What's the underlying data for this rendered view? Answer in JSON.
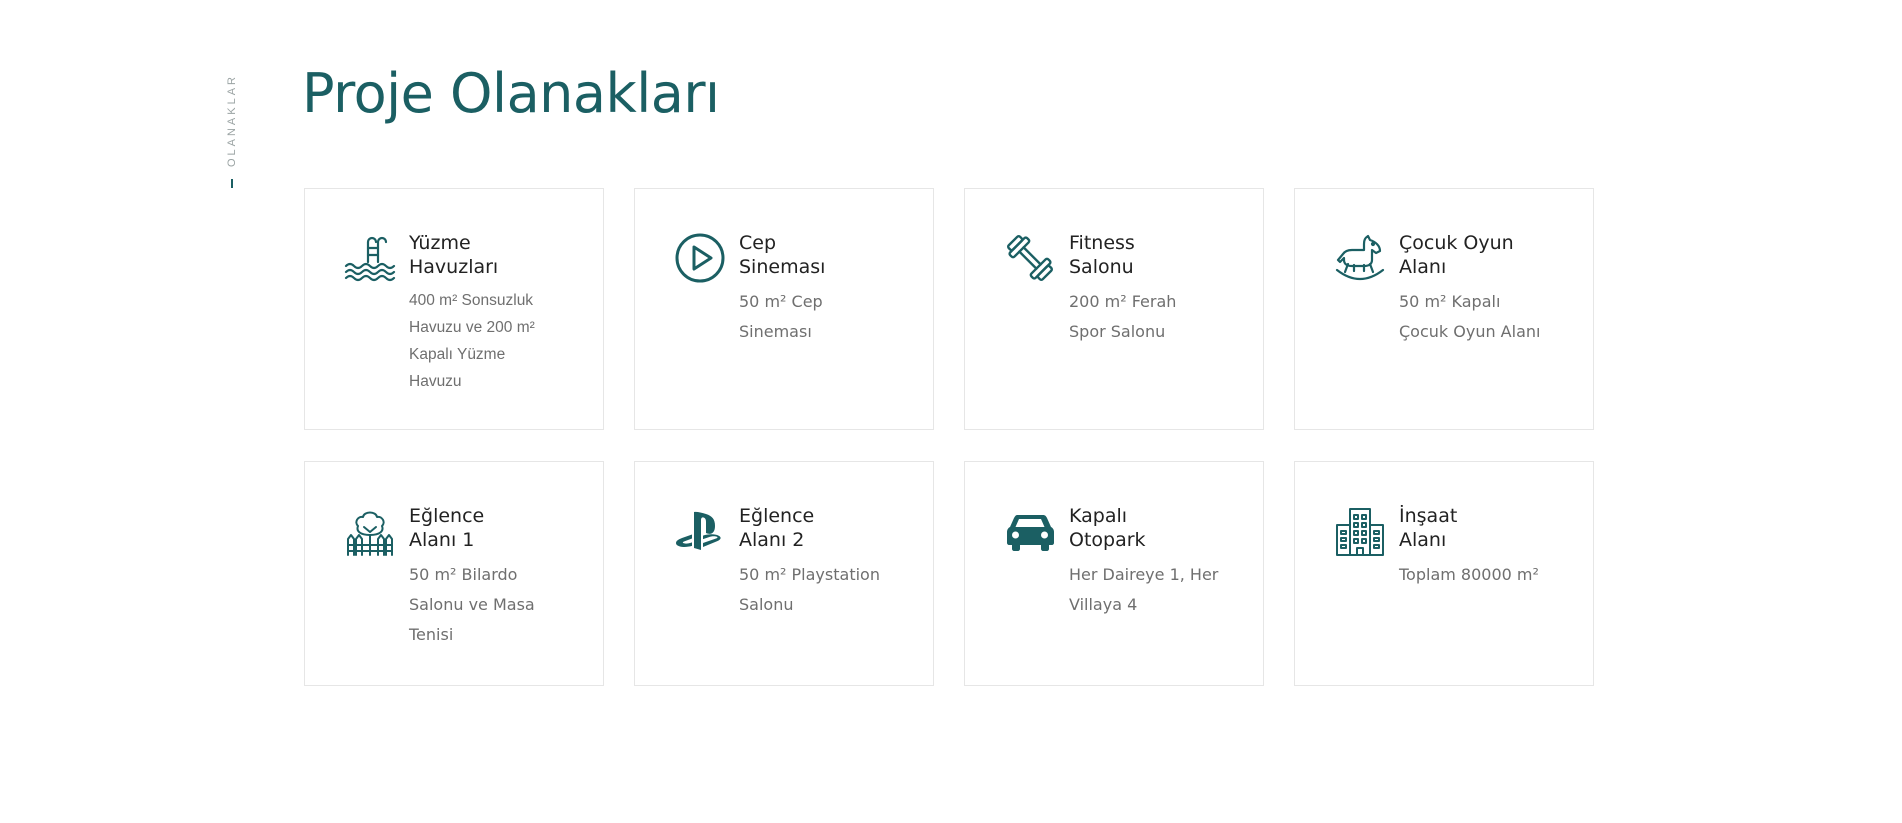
{
  "section": {
    "side_label": "OLANAKLAR",
    "title": "Proje Olanakları"
  },
  "colors": {
    "accent": "#1b5f63",
    "card_border": "#e6e6e6",
    "text": "#222222",
    "muted": "#6f6f6f"
  },
  "amenities": [
    {
      "icon": "swimming-pool-icon",
      "name": "Yüzme\nHavuzları",
      "desc": "400 m² Sonsuzluk\nHavuzu ve 200 m²\nKapalı Yüzme\nHavuzu"
    },
    {
      "icon": "play-icon",
      "name": "Cep\nSineması",
      "desc": "50 m² Cep\nSineması"
    },
    {
      "icon": "dumbbell-icon",
      "name": "Fitness\nSalonu",
      "desc": "200 m² Ferah\nSpor Salonu"
    },
    {
      "icon": "rocking-horse-icon",
      "name": "Çocuk Oyun\nAlanı",
      "desc": "50 m² Kapalı\nÇocuk Oyun Alanı"
    },
    {
      "icon": "park-icon",
      "name": "Eğlence\nAlanı 1",
      "desc": "50 m² Bilardo\nSalonu ve Masa\nTenisi"
    },
    {
      "icon": "playstation-icon",
      "name": "Eğlence\nAlanı 2",
      "desc": "50 m² Playstation\nSalonu"
    },
    {
      "icon": "car-icon",
      "name": "Kapalı\nOtopark",
      "desc": "Her Daireye 1, Her\nVillaya 4"
    },
    {
      "icon": "building-icon",
      "name": "İnşaat\nAlanı",
      "desc": "Toplam 80000 m²"
    }
  ]
}
